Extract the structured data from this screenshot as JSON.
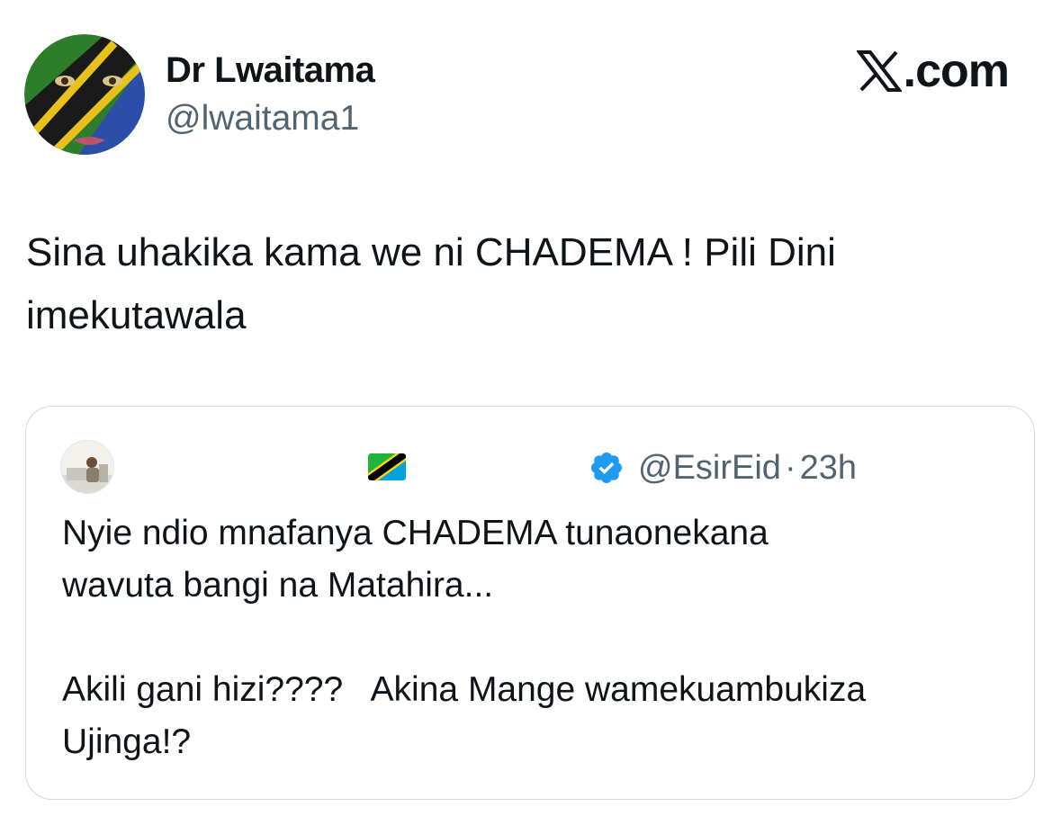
{
  "author": {
    "name": "Dr Lwaitama",
    "handle": "@lwaitama1"
  },
  "brand": {
    "logo_text": ".com",
    "logo_icon": "x-logo-icon"
  },
  "tweet": {
    "text": "Sina uhakika kama we ni CHADEMA ! Pili Dini\nimekutawala"
  },
  "quoted_tweet": {
    "flag_icon": "tanzania-flag-icon",
    "verified_icon": "verified-badge-icon",
    "handle": "@EsirEid",
    "separator": "·",
    "time": "23h",
    "text": "Nyie ndio mnafanya CHADEMA tunaonekana\nwavuta bangi na Matahira...\n\nAkili gani hizi????   Akina Mange wamekuambukiza\nUjinga!?"
  },
  "colors": {
    "text_primary": "#0f1419",
    "text_secondary": "#536471",
    "border": "#cfd9de",
    "verified_blue": "#1d9bf0"
  }
}
